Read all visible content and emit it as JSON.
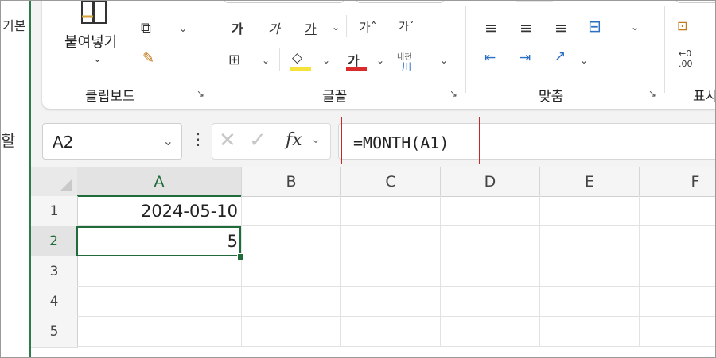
{
  "left_pane": {
    "text1": "기본",
    "text2": "할"
  },
  "ribbon": {
    "clipboard": {
      "label": "클립보드",
      "paste_label": "붙여넣기",
      "launcher": "↘"
    },
    "font": {
      "label": "글꼴",
      "launcher": "↘",
      "bold_glyph": "가",
      "italic_glyph": "가",
      "underline_glyph": "가",
      "grow_glyph": "가ˆ",
      "shrink_glyph": "가ˇ",
      "font_color_glyph": "가",
      "phonetic_top": "내천",
      "phonetic_bottom": "川",
      "fill_color": "#f5e33b",
      "font_color": "#d92b2b"
    },
    "alignment": {
      "label": "맞춤",
      "launcher": "↘"
    },
    "number": {
      "label": "표시",
      "digits_top": "←0",
      "digits_bottom": ".00"
    }
  },
  "formula_bar": {
    "name_box": "A2",
    "fx_label": "fx",
    "formula": "=MONTH(A1)"
  },
  "sheet": {
    "columns": [
      "A",
      "B",
      "C",
      "D",
      "E",
      "F"
    ],
    "rows": [
      "1",
      "2",
      "3",
      "4",
      "5"
    ],
    "cells": {
      "A1": "2024-05-10",
      "A2": "5"
    },
    "active_cell": "A2",
    "accent_color": "#1f6b3a",
    "highlight_color": "#c62828"
  }
}
